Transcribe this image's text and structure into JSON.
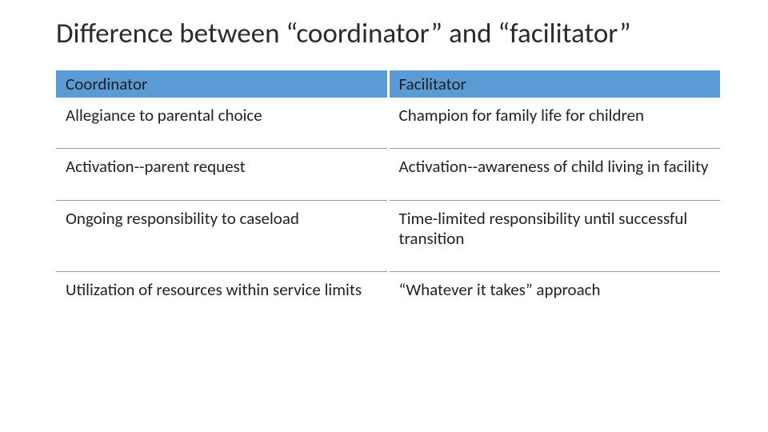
{
  "title": "Difference between “coordinator” and “facilitator”",
  "table": {
    "headers": [
      "Coordinator",
      "Facilitator"
    ],
    "rows": [
      [
        "Allegiance to parental choice",
        "Champion for family life for children"
      ],
      [
        "Activation--parent request",
        "Activation--awareness of child living in facility"
      ],
      [
        "Ongoing responsibility to caseload",
        "Time-limited responsibility until successful transition"
      ],
      [
        "Utilization of resources within service limits",
        "“Whatever it takes” approach"
      ]
    ]
  }
}
